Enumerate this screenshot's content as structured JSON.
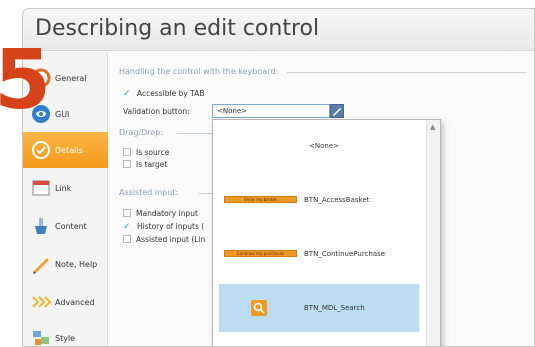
{
  "big_number": "5",
  "window": {
    "title": "Describing an edit control"
  },
  "sidebar": {
    "items": [
      {
        "label": "General",
        "icon": "general-icon"
      },
      {
        "label": "GUI",
        "icon": "gui-icon"
      },
      {
        "label": "Details",
        "icon": "details-icon",
        "active": true
      },
      {
        "label": "Link",
        "icon": "link-icon"
      },
      {
        "label": "Content",
        "icon": "content-icon"
      },
      {
        "label": "Note, Help",
        "icon": "note-help-icon"
      },
      {
        "label": "Advanced",
        "icon": "advanced-icon"
      },
      {
        "label": "Style",
        "icon": "style-icon"
      }
    ]
  },
  "main": {
    "keyboard_section": "Handling the control with the keyboard:",
    "accessible_tab_label": "Accessible by TAB",
    "validation_label": "Validation button:",
    "validation_value": "<None>",
    "dragdrop_section": "Drag/Drop:",
    "is_source": "Is source",
    "is_target": "Is target",
    "assisted_section": "Assisted input:",
    "mandatory_input": "Mandatory input",
    "history_inputs": "History of inputs (",
    "assisted_input": "Assisted input (Lin"
  },
  "dropdown": {
    "items": [
      {
        "label": "<None>"
      },
      {
        "label": "BTN_AccessBasket",
        "thumb": "Show my basket"
      },
      {
        "label": "BTN_ContinuePurchase",
        "thumb": "Continue my purchases"
      },
      {
        "label": "BTN_MDL_Search",
        "selected": true
      }
    ]
  },
  "colors": {
    "accent_orange": "#f39a1a",
    "big_number": "#d64319",
    "selection": "#bcdcf2",
    "section_text": "#8aa0b5"
  }
}
